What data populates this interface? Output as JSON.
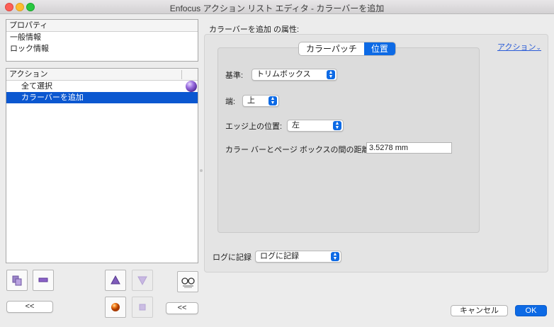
{
  "window": {
    "title": "Enfocus アクション リスト エディタ - カラーバーを追加"
  },
  "properties": {
    "header": "プロパティ",
    "items": [
      "一般情報",
      "ロック情報"
    ]
  },
  "actions": {
    "header": "アクション",
    "items": [
      "全て選択",
      "カラーバーを追加"
    ],
    "selected_index": 1
  },
  "left_buttons": {
    "collapse_label": "<<",
    "collapse_label_2": "<<"
  },
  "attributes": {
    "title": "カラーバーを追加 の属性:",
    "tabs": [
      "カラーパッチ",
      "位置"
    ],
    "active_tab": "位置",
    "action_menu": "アクション",
    "fields": {
      "base_label": "基準:",
      "base_value": "トリムボックス",
      "edge_label": "端:",
      "edge_value": "上",
      "position_label": "エッジ上の位置:",
      "position_value": "左",
      "distance_label": "カラー バーとページ ボックスの間の距離:",
      "distance_value": "3.5278 mm"
    },
    "log_label": "ログに記録",
    "log_value": "ログに記録"
  },
  "dialog": {
    "cancel": "キャンセル",
    "ok": "OK"
  },
  "colors": {
    "accent": "#0d6ae5",
    "selection": "#0b57d0",
    "link": "#2a5bd7"
  }
}
